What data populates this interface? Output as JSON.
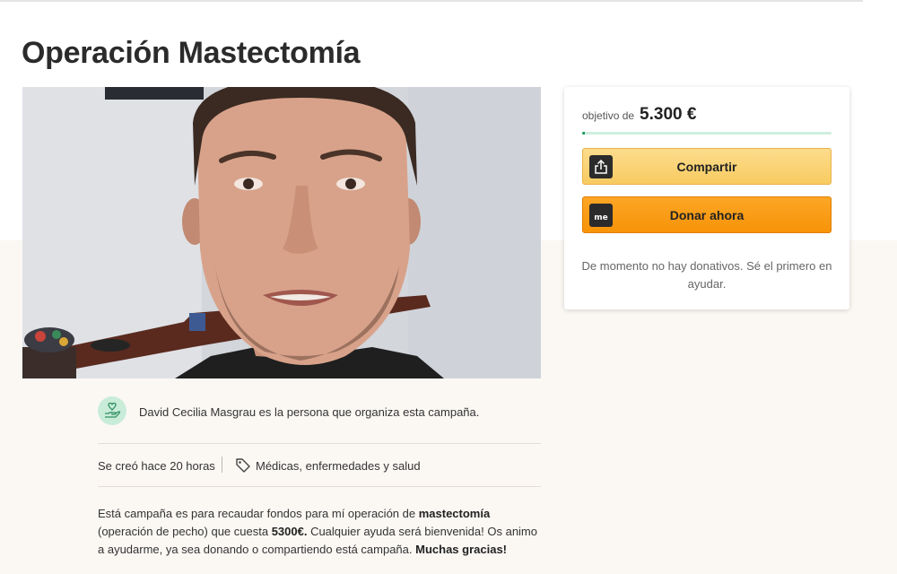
{
  "campaign": {
    "title": "Operación Mastectomía",
    "photo_icon": "campaign-photo"
  },
  "donation_card": {
    "goal_label": "objetivo de",
    "goal_amount": "5.300 €",
    "progress_fraction": 0.01,
    "share_label": "Compartir",
    "share_icon": "share-upload-icon",
    "donate_label": "Donar ahora",
    "donate_icon": "me-logo-icon",
    "donate_icon_text": "me",
    "no_donations_text": "De momento no hay donativos. Sé el primero en ayudar."
  },
  "organizer": {
    "icon": "organizer-heart-hand-icon",
    "text": "David Cecilia Masgrau es la persona que organiza esta campaña."
  },
  "meta": {
    "created": "Se creó hace 20 horas",
    "category_icon": "tag-icon",
    "category": "Médicas, enfermedades y salud"
  },
  "description": {
    "part1": "Está campaña es para recaudar fondos para mí operación de ",
    "bold1": "mastectomía",
    "part2": " (operación de pecho) que cuesta ",
    "bold2": "5300€.",
    "part3": " Cualquier ayuda será bienvenida! Os animo a ayudarme, ya sea donando o compartiendo está campaña. ",
    "bold3": "Muchas gracias!"
  },
  "colors": {
    "share_button": "#f8cb61",
    "donate_button": "#f79308",
    "progress": "#1a9c5b",
    "avatar_bg": "#c9ecd9",
    "page_bottom_bg": "#fbf8f4"
  }
}
